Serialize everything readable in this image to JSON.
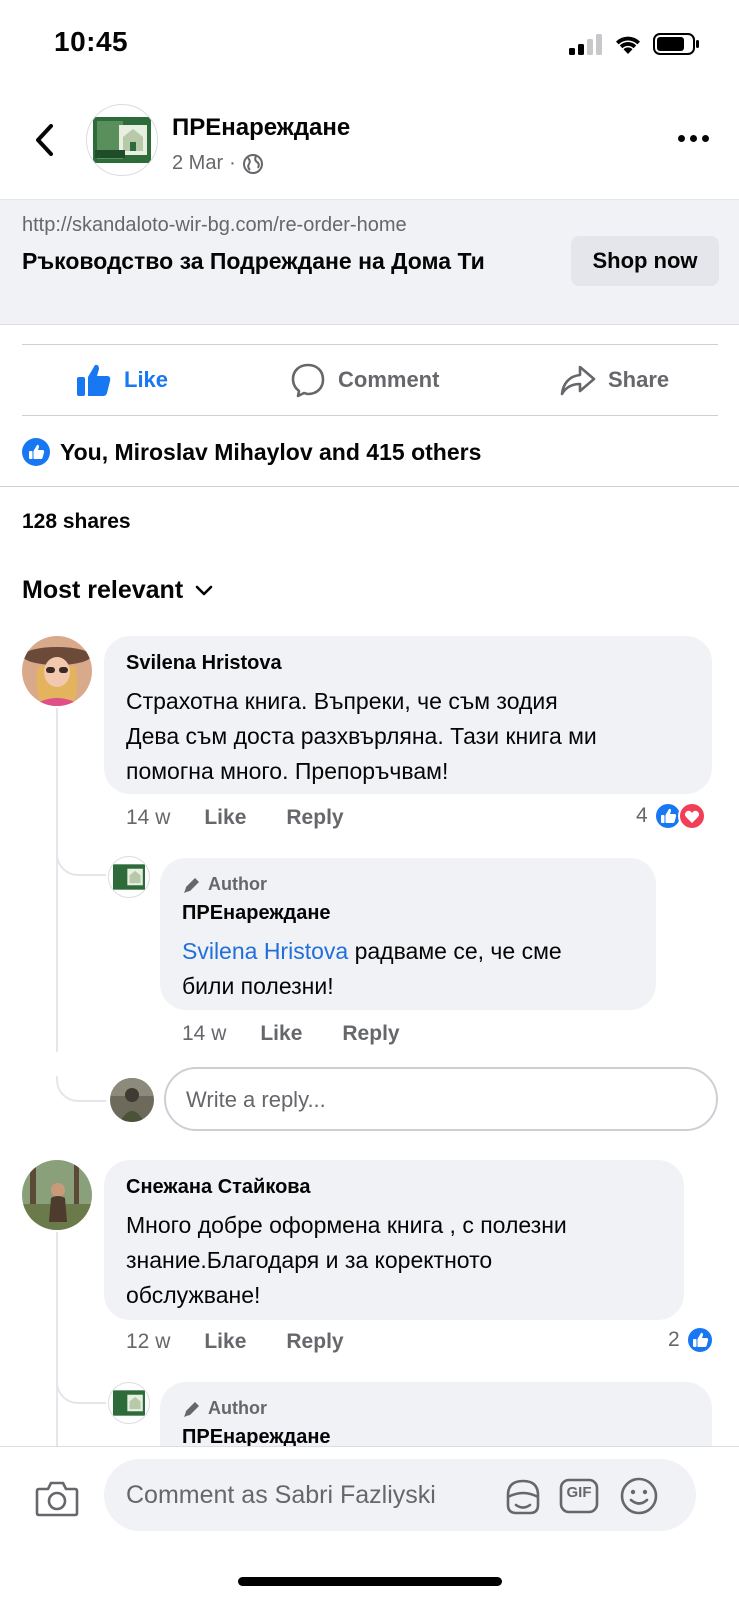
{
  "status_bar": {
    "time": "10:45"
  },
  "post": {
    "page_name": "ПРЕнареждане",
    "date": "2 Mar",
    "meta_separator": "·",
    "avatar_mini_text": "НАДАМ"
  },
  "link_card": {
    "url": "http://skandaloto-wir-bg.com/re-order-home",
    "title": "Ръководство за Подреждане на Дома Ти",
    "cta": "Shop now"
  },
  "actions": {
    "like": "Like",
    "comment": "Comment",
    "share": "Share"
  },
  "reactions_summary": "You, Miroslav Mihaylov and 415 others",
  "shares": "128 shares",
  "sort_label": "Most relevant",
  "comments": [
    {
      "name": "Svilena Hristova",
      "lines": [
        "Страхотна книга. Въпреки, че съм зодия",
        "Дева съм доста разхвърляна. Тази книга ми",
        "помогна много. Препоръчвам!"
      ],
      "time": "14 w",
      "like": "Like",
      "reply": "Reply",
      "reaction_count": "4",
      "replies": [
        {
          "author_tag": "Author",
          "name": "ПРЕнареждане",
          "mention": "Svilena Hristova",
          "line1_rest": " радваме се, че сме",
          "line2": "били полезни!",
          "time": "14 w",
          "like": "Like",
          "reply": "Reply"
        }
      ]
    },
    {
      "name": "Снежана Стайкова",
      "lines": [
        "Много добре оформена книга , с полезни",
        "знание.Благодаря и за коректното",
        "обслужване!"
      ],
      "time": "12 w",
      "like": "Like",
      "reply": "Reply",
      "reaction_count": "2",
      "replies": [
        {
          "author_tag": "Author",
          "name": "ПРЕнареждане"
        }
      ]
    }
  ],
  "reply_placeholder": "Write a reply...",
  "comment_bar": {
    "placeholder": "Comment as Sabri Fazliyski",
    "gif": "GIF"
  },
  "colors": {
    "accent": "#1877f2",
    "love": "#f33e58",
    "bubble": "#f0f2f5",
    "secondary_text": "#65676b"
  }
}
